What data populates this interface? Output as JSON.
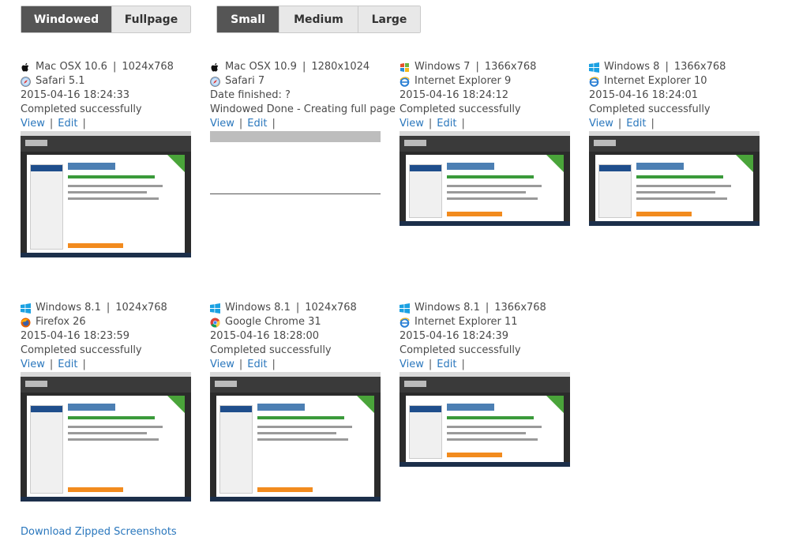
{
  "view_toggle": {
    "windowed": "Windowed",
    "fullpage": "Fullpage"
  },
  "size_toggle": {
    "small": "Small",
    "medium": "Medium",
    "large": "Large"
  },
  "view_label": "View",
  "edit_label": "Edit",
  "link_separator": "|",
  "os_separator": "|",
  "screenshots": [
    {
      "os": "Mac OSX 10.6",
      "resolution": "1024x768",
      "browser": "Safari 5.1",
      "date": "2015-04-16 18:24:33",
      "status": "Completed successfully",
      "os_icon": "apple-icon",
      "browser_icon": "safari-icon"
    },
    {
      "os": "Mac OSX 10.9",
      "resolution": "1280x1024",
      "browser": "Safari 7",
      "date": "Date finished: ?",
      "status": "Windowed Done - Creating full page",
      "os_icon": "apple-icon",
      "browser_icon": "safari-icon"
    },
    {
      "os": "Windows 7",
      "resolution": "1366x768",
      "browser": "Internet Explorer 9",
      "date": "2015-04-16 18:24:12",
      "status": "Completed successfully",
      "os_icon": "windows7-icon",
      "browser_icon": "ie-icon"
    },
    {
      "os": "Windows 8",
      "resolution": "1366x768",
      "browser": "Internet Explorer 10",
      "date": "2015-04-16 18:24:01",
      "status": "Completed successfully",
      "os_icon": "windows8-icon",
      "browser_icon": "ie-icon"
    },
    {
      "os": "Windows 8.1",
      "resolution": "1024x768",
      "browser": "Firefox 26",
      "date": "2015-04-16 18:23:59",
      "status": "Completed successfully",
      "os_icon": "windows8-icon",
      "browser_icon": "firefox-icon"
    },
    {
      "os": "Windows 8.1",
      "resolution": "1024x768",
      "browser": "Google Chrome 31",
      "date": "2015-04-16 18:28:00",
      "status": "Completed successfully",
      "os_icon": "windows8-icon",
      "browser_icon": "chrome-icon"
    },
    {
      "os": "Windows 8.1",
      "resolution": "1366x768",
      "browser": "Internet Explorer 11",
      "date": "2015-04-16 18:24:39",
      "status": "Completed successfully",
      "os_icon": "windows8-icon",
      "browser_icon": "ie-icon"
    }
  ],
  "download_label": "Download Zipped Screenshots",
  "colors": {
    "link": "#2a77bd",
    "active_toggle": "#555555"
  }
}
